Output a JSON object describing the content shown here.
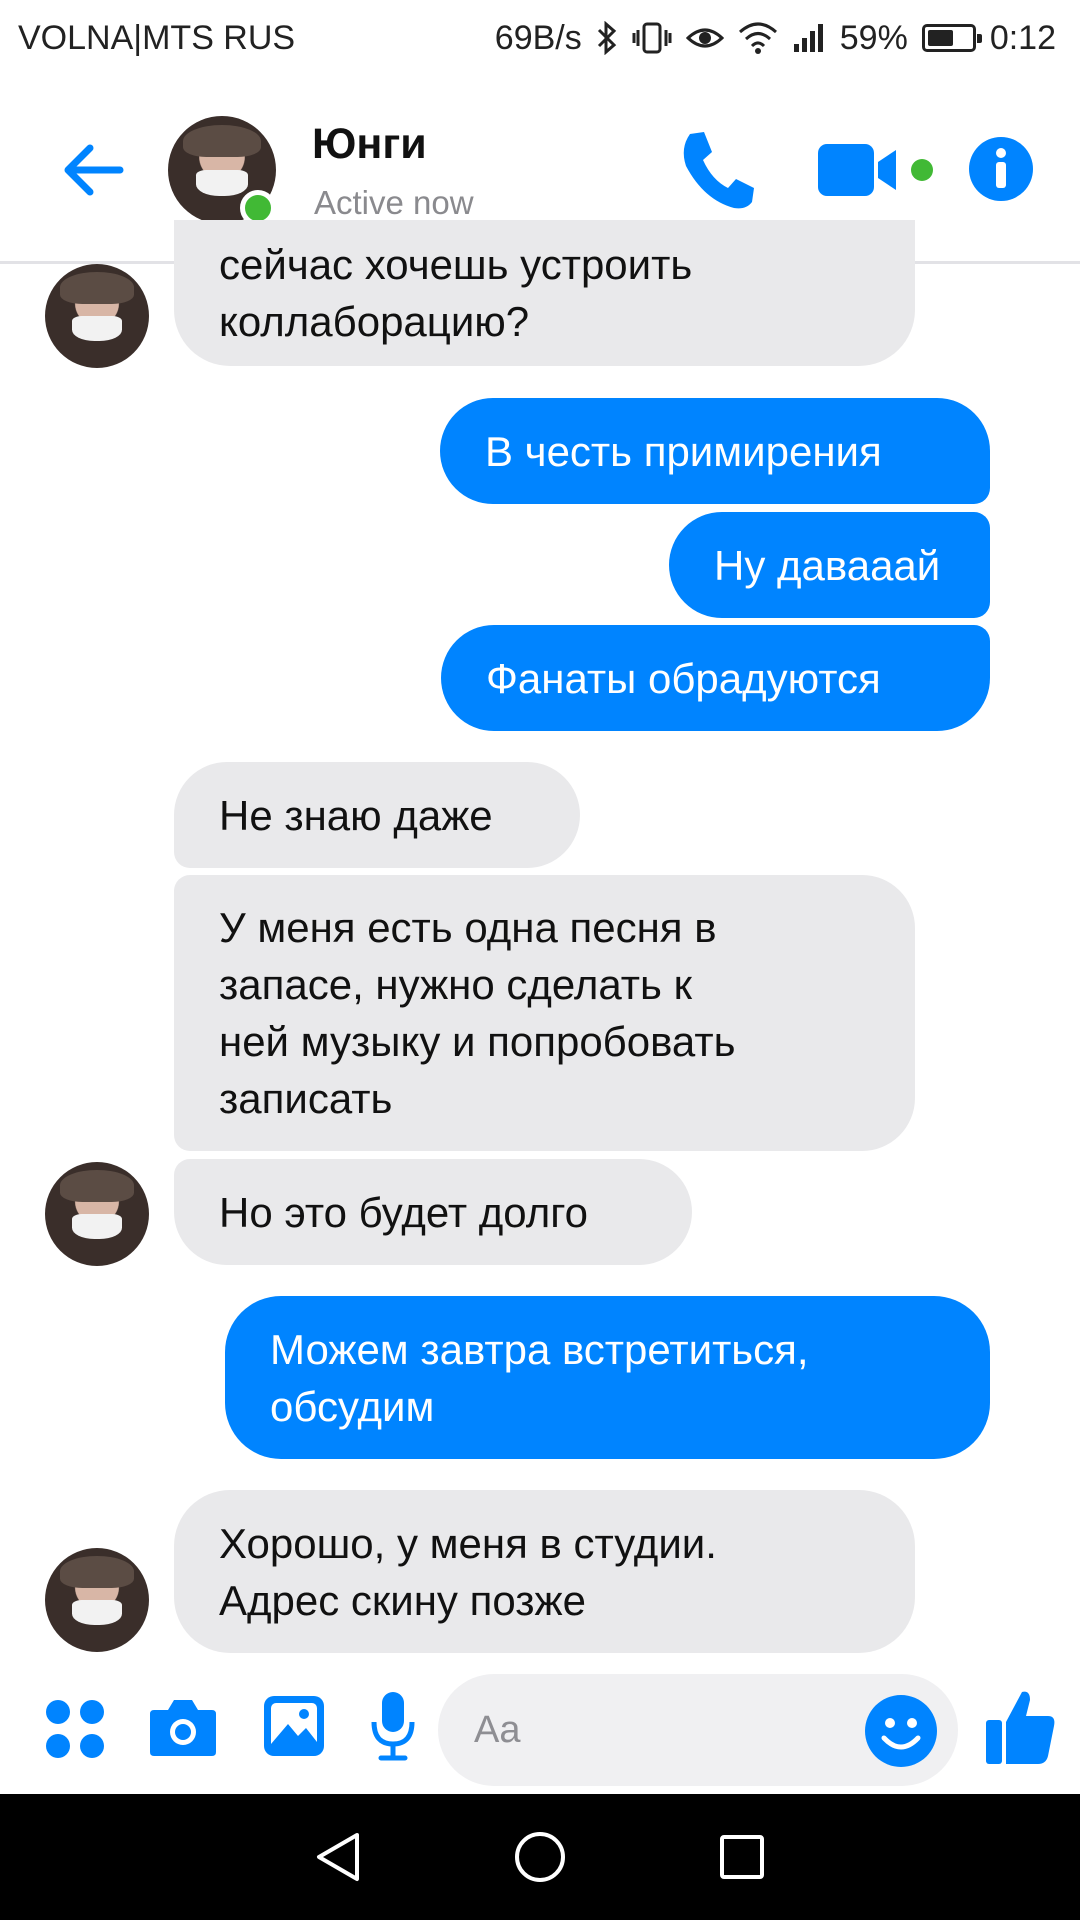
{
  "status_bar": {
    "carrier": "VOLNA|MTS RUS",
    "speed": "69B/s",
    "battery_percent": "59%",
    "battery_level": 0.59,
    "time": "0:12"
  },
  "header": {
    "contact_name": "Юнги",
    "status": "Active now"
  },
  "messages": [
    {
      "sender": "them",
      "text": "сейчас хочешь устроить\nколлаборацию?"
    },
    {
      "sender": "me",
      "text": "В честь примирения"
    },
    {
      "sender": "me",
      "text": "Ну давааай"
    },
    {
      "sender": "me",
      "text": "Фанаты обрадуются"
    },
    {
      "sender": "them",
      "text": "Не знаю даже"
    },
    {
      "sender": "them",
      "text": "У меня есть одна песня в\nзапасе, нужно сделать к\nней музыку и попробовать\nзаписать"
    },
    {
      "sender": "them",
      "text": "Но это будет долго"
    },
    {
      "sender": "me",
      "text": "Можем завтра встретиться,\nобсудим"
    },
    {
      "sender": "them",
      "text": "Хорошо, у меня в студии.\nАдрес скину позже"
    }
  ],
  "composer": {
    "placeholder": "Aa"
  },
  "colors": {
    "accent": "#0084ff",
    "incoming_bubble": "#e9e9eb",
    "online": "#41b935"
  },
  "icons": [
    "back-arrow-icon",
    "phone-icon",
    "video-camera-icon",
    "info-icon",
    "apps-grid-icon",
    "camera-icon",
    "image-icon",
    "microphone-icon",
    "emoji-icon",
    "thumbs-up-icon",
    "nav-back-icon",
    "nav-home-icon",
    "nav-recents-icon"
  ]
}
